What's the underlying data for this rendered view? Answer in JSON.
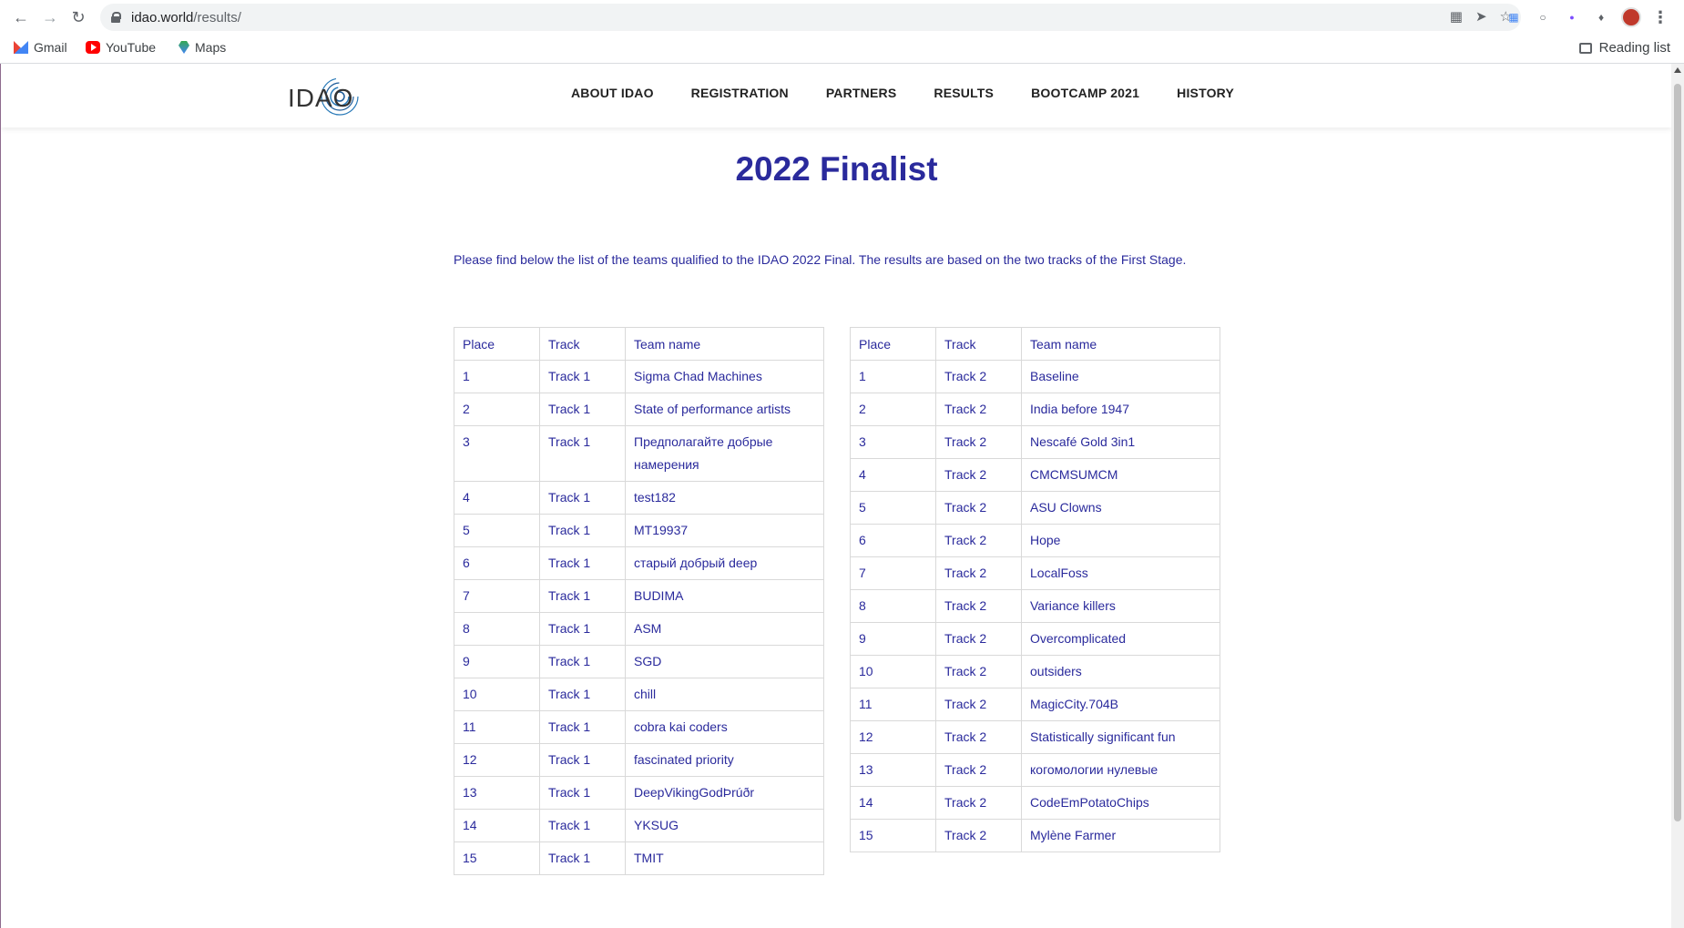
{
  "browser": {
    "url_host": "idao.world",
    "url_path": "/results/",
    "bookmarks": [
      "Gmail",
      "YouTube",
      "Maps"
    ],
    "reading_list": "Reading list"
  },
  "site": {
    "logo_text": "IDAO",
    "nav": [
      "ABOUT IDAO",
      "REGISTRATION",
      "PARTNERS",
      "RESULTS",
      "BOOTCAMP 2021",
      "HISTORY"
    ]
  },
  "main": {
    "title": "2022 Finalist",
    "intro": "Please find below the list of the teams qualified to the IDAO 2022 Final. The results are based on the two tracks of the First Stage."
  },
  "tables": {
    "headers": [
      "Place",
      "Track",
      "Team name"
    ],
    "track1": [
      [
        "1",
        "Track 1",
        "Sigma Chad Machines"
      ],
      [
        "2",
        "Track 1",
        "State of performance artists"
      ],
      [
        "3",
        "Track 1",
        "Предполагайте добрые намерения"
      ],
      [
        "4",
        "Track 1",
        "test182"
      ],
      [
        "5",
        "Track 1",
        "MT19937"
      ],
      [
        "6",
        "Track 1",
        "старый добрый deep"
      ],
      [
        "7",
        "Track 1",
        "BUDIMA"
      ],
      [
        "8",
        "Track 1",
        "ASM"
      ],
      [
        "9",
        "Track 1",
        "SGD"
      ],
      [
        "10",
        "Track 1",
        "chill"
      ],
      [
        "11",
        "Track 1",
        "cobra kai coders"
      ],
      [
        "12",
        "Track 1",
        "fascinated priority"
      ],
      [
        "13",
        "Track 1",
        "DeepVikingGodÞrúðr"
      ],
      [
        "14",
        "Track 1",
        "YKSUG"
      ],
      [
        "15",
        "Track 1",
        "TMIT"
      ]
    ],
    "track2": [
      [
        "1",
        "Track 2",
        "Baseline"
      ],
      [
        "2",
        "Track 2",
        "India before 1947"
      ],
      [
        "3",
        "Track 2",
        "Nescafé Gold 3in1"
      ],
      [
        "4",
        "Track 2",
        "CMCMSUMCM"
      ],
      [
        "5",
        "Track 2",
        "ASU Clowns"
      ],
      [
        "6",
        "Track 2",
        "Hope"
      ],
      [
        "7",
        "Track 2",
        "LocalFoss"
      ],
      [
        "8",
        "Track 2",
        "Variance killers"
      ],
      [
        "9",
        "Track 2",
        "Overcomplicated"
      ],
      [
        "10",
        "Track 2",
        "outsiders"
      ],
      [
        "11",
        "Track 2",
        "MagicCity.704B"
      ],
      [
        "12",
        "Track 2",
        "Statistically significant fun"
      ],
      [
        "13",
        "Track 2",
        "когомологии нулевые"
      ],
      [
        "14",
        "Track 2",
        "CodeEmPotatoChips"
      ],
      [
        "15",
        "Track 2",
        "Mylène Farmer"
      ]
    ]
  },
  "colors": {
    "accent": "#2a2a9c"
  }
}
